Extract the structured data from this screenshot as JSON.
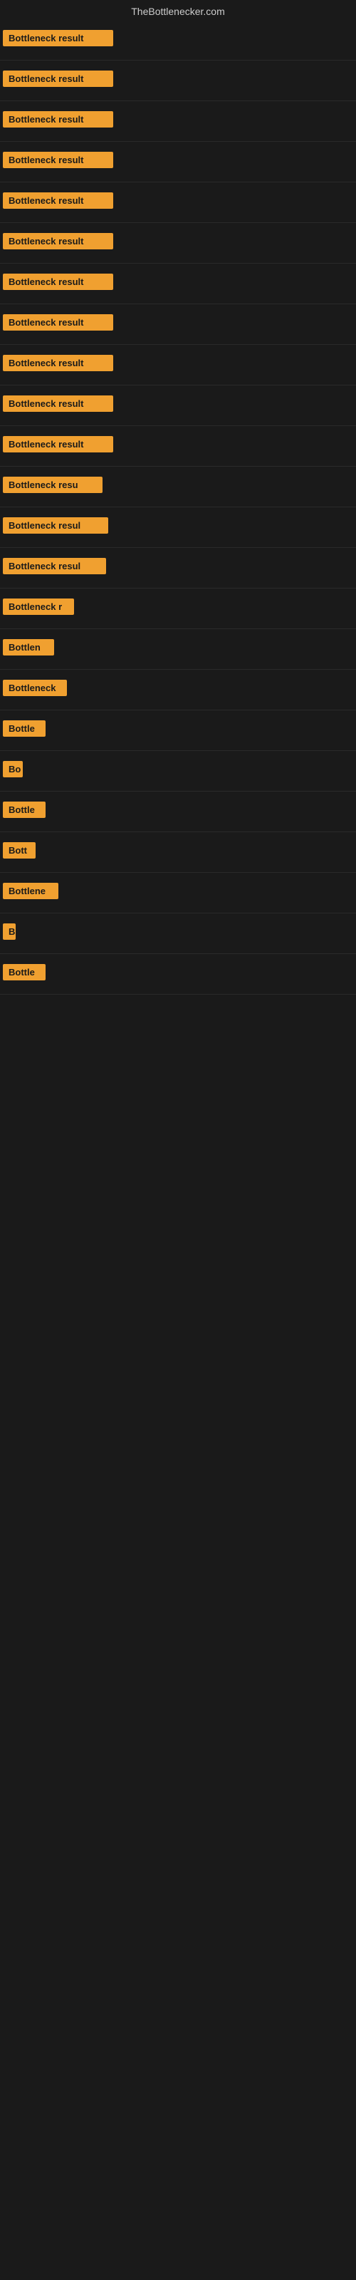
{
  "site": {
    "title": "TheBottlenecker.com"
  },
  "rows": [
    {
      "label": "Bottleneck result",
      "width": "full"
    },
    {
      "label": "Bottleneck result",
      "width": "full"
    },
    {
      "label": "Bottleneck result",
      "width": "full"
    },
    {
      "label": "Bottleneck result",
      "width": "full"
    },
    {
      "label": "Bottleneck result",
      "width": "full"
    },
    {
      "label": "Bottleneck result",
      "width": "full"
    },
    {
      "label": "Bottleneck result",
      "width": "full"
    },
    {
      "label": "Bottleneck result",
      "width": "full"
    },
    {
      "label": "Bottleneck result",
      "width": "full"
    },
    {
      "label": "Bottleneck result",
      "width": "full"
    },
    {
      "label": "Bottleneck result",
      "width": "full"
    },
    {
      "label": "Bottleneck resu",
      "width": "partial-1"
    },
    {
      "label": "Bottleneck resul",
      "width": "partial-2"
    },
    {
      "label": "Bottleneck resul",
      "width": "partial-3"
    },
    {
      "label": "Bottleneck r",
      "width": "partial-4"
    },
    {
      "label": "Bottlen",
      "width": "partial-5"
    },
    {
      "label": "Bottleneck",
      "width": "partial-6"
    },
    {
      "label": "Bottle",
      "width": "partial-7"
    },
    {
      "label": "Bo",
      "width": "partial-8"
    },
    {
      "label": "Bottle",
      "width": "partial-7"
    },
    {
      "label": "Bott",
      "width": "partial-9"
    },
    {
      "label": "Bottlene",
      "width": "partial-10"
    },
    {
      "label": "B",
      "width": "partial-11"
    },
    {
      "label": "Bottle",
      "width": "partial-7"
    }
  ]
}
